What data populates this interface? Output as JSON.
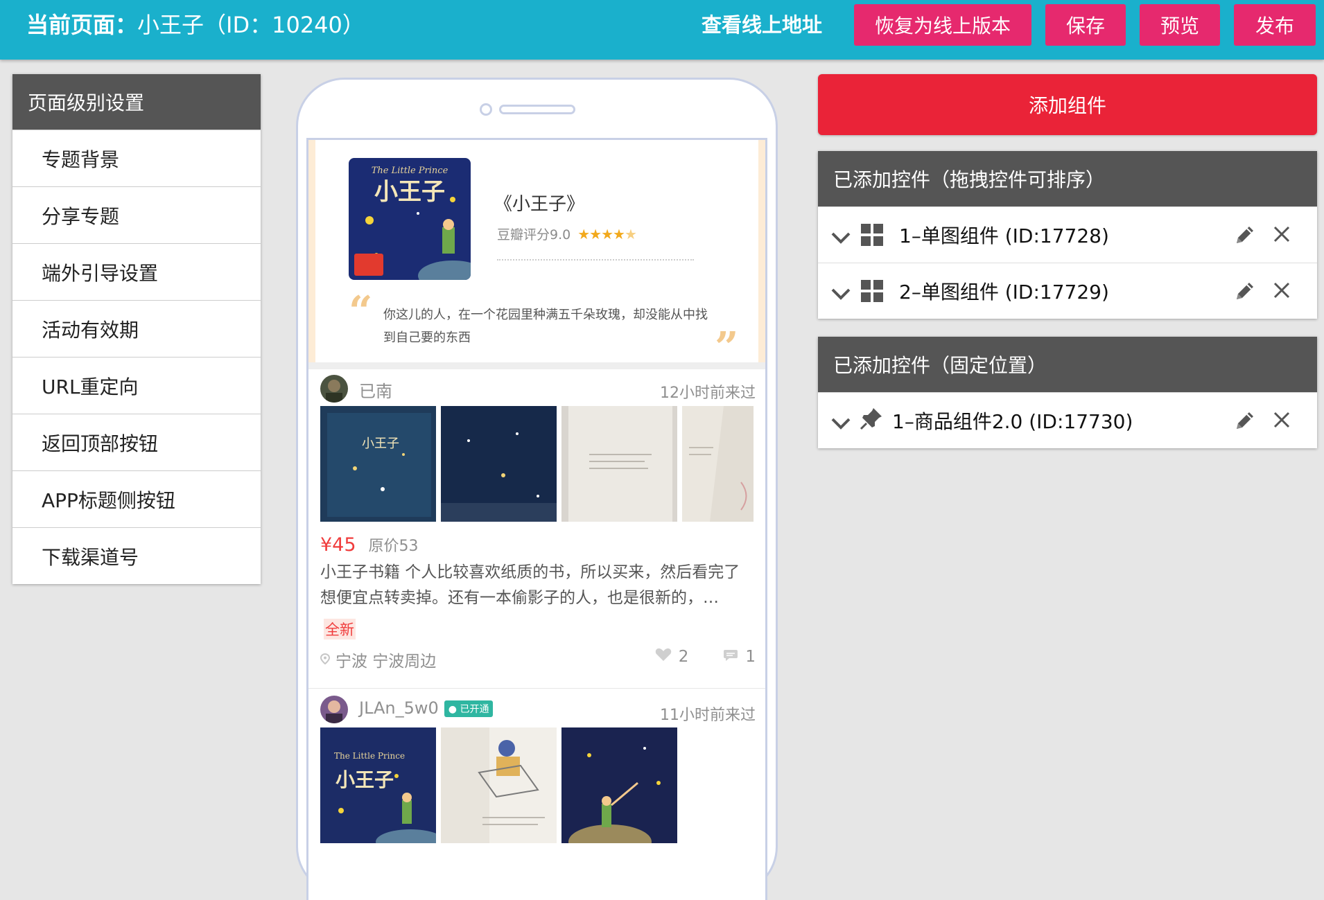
{
  "header": {
    "page_label": "当前页面：",
    "page_value": "小王子（ID：10240）",
    "view_online": "查看线上地址",
    "buttons": [
      "恢复为线上版本",
      "保存",
      "预览",
      "发布"
    ],
    "bg_color": "#1ab0cc",
    "button_color": "#e6296e"
  },
  "left_panel": {
    "title": "页面级别设置",
    "items": [
      "专题背景",
      "分享专题",
      "端外引导设置",
      "活动有效期",
      "URL重定向",
      "返回顶部按钮",
      "APP标题侧按钮",
      "下载渠道号"
    ]
  },
  "phone": {
    "book": {
      "cover_title_en": "The Little Prince",
      "cover_title_cn": "小王子",
      "title": "《小王子》",
      "douban": "豆瓣评分9.0",
      "rating_stars": 4.5,
      "quote": "你这儿的人，在一个花园里种满五千朵玫瑰，却没能从中找到自己要的东西"
    },
    "posts": [
      {
        "user": "已南",
        "time": "12小时前来过",
        "price": "¥45",
        "original_price": "原价53",
        "description": "小王子书籍 个人比较喜欢纸质的书，所以买来，然后看完了想便宜点转卖掉。还有一本偷影子的人，也是很新的，…",
        "tag": "全新",
        "location": "宁波 宁波周边",
        "likes": "2",
        "comments": "1"
      },
      {
        "user": "JLAn_5w0",
        "badge": "已开通",
        "time": "11小时前来过",
        "cover_title_en": "The Little Prince",
        "cover_title_cn": "小王子"
      }
    ]
  },
  "right_panel": {
    "add_button": "添加组件",
    "add_color": "#ea2338",
    "sortable": {
      "title": "已添加控件（拖拽控件可排序）",
      "items": [
        "1–单图组件 (ID:17728)",
        "2–单图组件 (ID:17729)"
      ]
    },
    "fixed": {
      "title": "已添加控件（固定位置）",
      "items": [
        "1–商品组件2.0 (ID:17730)"
      ]
    }
  }
}
